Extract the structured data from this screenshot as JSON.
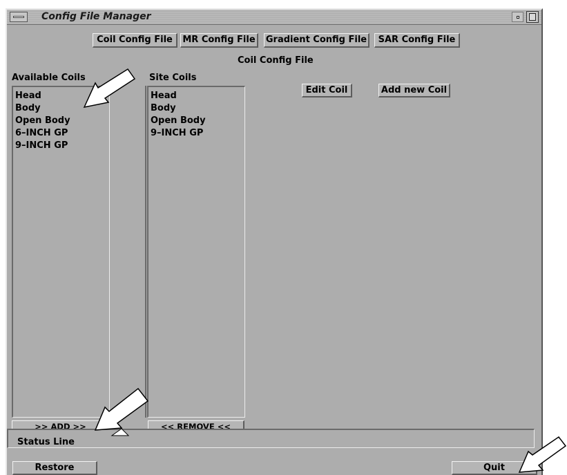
{
  "window": {
    "title": "Config File Manager"
  },
  "file_tabs": [
    {
      "label": "Coil Config File"
    },
    {
      "label": "MR Config File"
    },
    {
      "label": "Gradient Config File"
    },
    {
      "label": "SAR Config File"
    }
  ],
  "section_title": "Coil Config File",
  "available_coils": {
    "label": "Available Coils",
    "items": [
      "Head",
      "Body",
      "Open Body",
      "6–INCH GP",
      "9–INCH GP"
    ]
  },
  "site_coils": {
    "label": "Site Coils",
    "items": [
      "Head",
      "Body",
      "Open Body",
      "9–INCH GP"
    ]
  },
  "actions": {
    "edit_coil": "Edit Coil",
    "add_new_coil": "Add new Coil",
    "add": ">> ADD >>",
    "remove": "<< REMOVE <<",
    "restore": "Restore",
    "quit": "Quit"
  },
  "status": {
    "text": "Status Line"
  }
}
